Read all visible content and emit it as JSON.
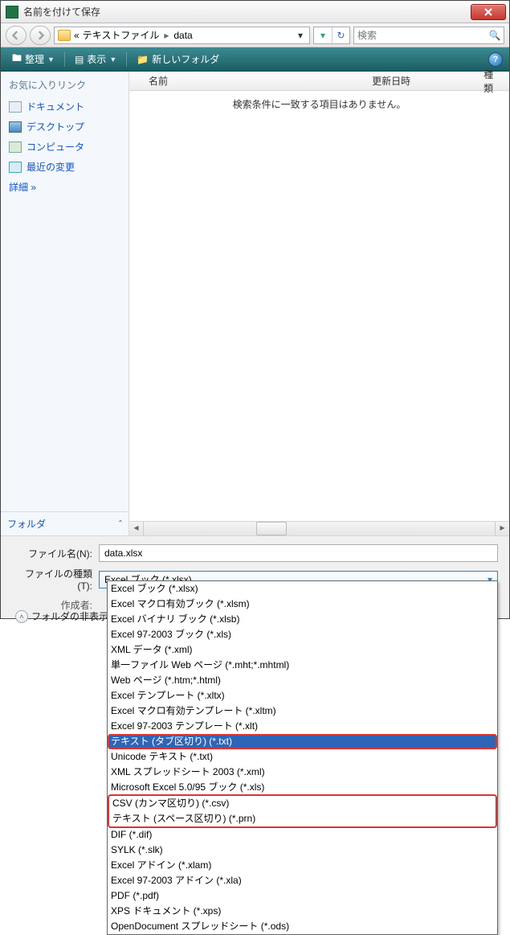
{
  "window": {
    "title": "名前を付けて保存"
  },
  "breadcrumb": {
    "prefix": "«",
    "folder1": "テキストファイル",
    "sep": "▸",
    "folder2": "data"
  },
  "search": {
    "placeholder": "検索"
  },
  "toolbar": {
    "organize": "整理",
    "view": "表示",
    "newfolder": "新しいフォルダ"
  },
  "sidebar": {
    "heading": "お気に入りリンク",
    "items": [
      {
        "label": "ドキュメント"
      },
      {
        "label": "デスクトップ"
      },
      {
        "label": "コンピュータ"
      },
      {
        "label": "最近の変更"
      }
    ],
    "detail": "詳細 »",
    "folders": "フォルダ"
  },
  "columns": {
    "name": "名前",
    "date": "更新日時",
    "type": "種類"
  },
  "noresults": "検索条件に一致する項目はありません。",
  "form": {
    "filename_label": "ファイル名(N):",
    "filename_value": "data.xlsx",
    "filetype_label": "ファイルの種類(T):",
    "filetype_selected": "Excel ブック (*.xlsx)",
    "author_label": "作成者:",
    "hidefolders": "フォルダの非表示"
  },
  "filetype_options": [
    "Excel ブック (*.xlsx)",
    "Excel マクロ有効ブック (*.xlsm)",
    "Excel バイナリ ブック (*.xlsb)",
    "Excel 97-2003 ブック (*.xls)",
    "XML データ (*.xml)",
    "単一ファイル Web ページ (*.mht;*.mhtml)",
    "Web ページ (*.htm;*.html)",
    "Excel テンプレート (*.xltx)",
    "Excel マクロ有効テンプレート (*.xltm)",
    "Excel 97-2003 テンプレート (*.xlt)",
    "テキスト (タブ区切り) (*.txt)",
    "Unicode テキスト (*.txt)",
    "XML スプレッドシート 2003 (*.xml)",
    "Microsoft Excel 5.0/95 ブック (*.xls)",
    "CSV (カンマ区切り) (*.csv)",
    "テキスト (スペース区切り) (*.prn)",
    "DIF (*.dif)",
    "SYLK (*.slk)",
    "Excel アドイン (*.xlam)",
    "Excel 97-2003 アドイン (*.xla)",
    "PDF (*.pdf)",
    "XPS ドキュメント (*.xps)",
    "OpenDocument スプレッドシート (*.ods)"
  ]
}
